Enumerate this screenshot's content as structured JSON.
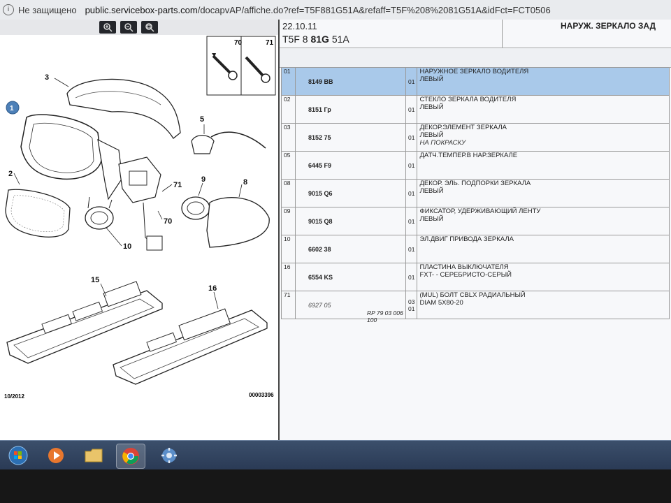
{
  "browser": {
    "security_label": "Не защищено",
    "url_host": "public.servicebox-parts.com",
    "url_path": "/docapvAP/affiche.do?ref=T5F881G51A&refaff=T5F%208%2081G51A&idFct=FCT0506"
  },
  "diagram": {
    "zoom_buttons": [
      "zoom-in-icon",
      "zoom-out-icon",
      "zoom-fit-icon"
    ],
    "callouts": [
      "1",
      "2",
      "3",
      "5",
      "8",
      "9",
      "10",
      "15",
      "16",
      "70",
      "71",
      "71",
      "70"
    ],
    "inset_labels": [
      "70",
      "71"
    ],
    "footer_date": "10/2012",
    "footer_number": "00003396"
  },
  "header": {
    "date": "22.10.11",
    "code_prefix": "T5F 8 ",
    "code_bold": "81G",
    "code_suffix": " 51A",
    "title": "НАРУЖ. ЗЕРКАЛО ЗАД"
  },
  "parts": [
    {
      "idx": "01",
      "ref": "8149 BB",
      "qty": "01",
      "desc": [
        "НАРУЖНОЕ ЗЕРКАЛО ВОДИТЕЛЯ",
        "ЛЕВЫЙ"
      ],
      "selected": true
    },
    {
      "idx": "02",
      "ref": "8151 Гр",
      "qty": "01",
      "desc": [
        "СТЕКЛО ЗЕРКАЛА ВОДИТЕЛЯ",
        "ЛЕВЫЙ"
      ]
    },
    {
      "idx": "03",
      "ref": "8152 75",
      "qty": "01",
      "desc": [
        "ДЕКОР.ЭЛЕМЕНТ ЗЕРКАЛА",
        "ЛЕВЫЙ"
      ],
      "note": "НА ПОКРАСКУ"
    },
    {
      "idx": "05",
      "ref": "6445 F9",
      "qty": "01",
      "desc": [
        "ДАТЧ.ТЕМПЕР.В НАР.ЗЕРКАЛЕ"
      ]
    },
    {
      "idx": "08",
      "ref": "9015 Q6",
      "qty": "01",
      "desc": [
        "ДЕКОР. ЭЛЬ. ПОДПОРКИ ЗЕРКАЛА",
        "ЛЕВЫЙ"
      ]
    },
    {
      "idx": "09",
      "ref": "9015 Q8",
      "qty": "01",
      "desc": [
        "ФИКСАТОР, УДЕРЖИВАЮЩИЙ ЛЕНТУ",
        "ЛЕВЫЙ"
      ]
    },
    {
      "idx": "10",
      "ref": "6602 38",
      "qty": "01",
      "desc": [
        "ЭЛ.ДВИГ ПРИВОДА ЗЕРКАЛА"
      ]
    },
    {
      "idx": "16",
      "ref": "6554 KS",
      "qty": "01",
      "desc": [
        "ПЛАСТИНА ВЫКЛЮЧАТЕЛЯ",
        "FXT- - СЕРЕБРИСТО-СЕРЫЙ"
      ]
    },
    {
      "idx": "71",
      "ref": "6927 05",
      "ref2": "RP 79 03 006 100",
      "qty": "03",
      "qty2": "01",
      "desc": [
        "(MUL) БОЛТ CBLX РАДИАЛЬНЫЙ",
        "DIAM 5X80-20"
      ],
      "ref_italic": true
    }
  ],
  "taskbar": {
    "items": [
      "start-orb-icon",
      "media-player-icon",
      "file-explorer-icon",
      "chrome-icon",
      "app-gear-icon"
    ]
  },
  "colors": {
    "selected_row": "#a9c9ea",
    "taskbar": "#2f4260"
  }
}
